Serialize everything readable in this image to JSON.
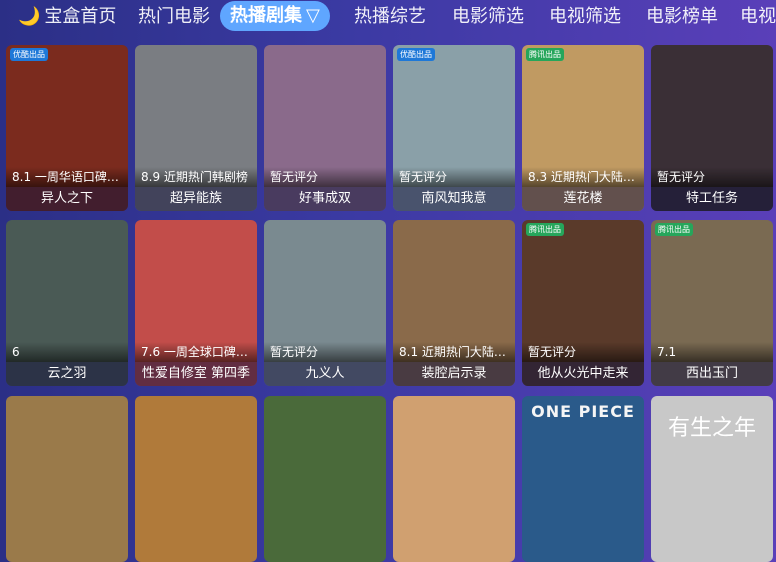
{
  "tabs": [
    {
      "label": "宝盒首页",
      "active": false,
      "icon": "moon-icon"
    },
    {
      "label": "热门电影",
      "active": false
    },
    {
      "label": "热播剧集",
      "active": true,
      "icon": "filter-icon"
    },
    {
      "label": "热播综艺",
      "active": false
    },
    {
      "label": "电影筛选",
      "active": false
    },
    {
      "label": "电视筛选",
      "active": false
    },
    {
      "label": "电影榜单",
      "active": false
    },
    {
      "label": "电视",
      "active": false
    }
  ],
  "row1": [
    {
      "title": "异人之下",
      "info": "8.1 一周华语口碑…",
      "badge": "优酷出品",
      "color": "#7b2b1e"
    },
    {
      "title": "超异能族",
      "info": "8.9 近期热门韩剧榜",
      "badge": "",
      "color": "#7a7d82"
    },
    {
      "title": "好事成双",
      "info": "暂无评分",
      "badge": "",
      "color": "#8a6a8b"
    },
    {
      "title": "南风知我意",
      "info": "暂无评分",
      "badge": "优酷出品",
      "color": "#8aa0a8"
    },
    {
      "title": "莲花楼",
      "info": "8.3 近期热门大陆…",
      "badge": "腾讯出品",
      "color": "#c09a62"
    },
    {
      "title": "特工任务",
      "info": "暂无评分",
      "badge": "",
      "color": "#3a2f36"
    }
  ],
  "row2": [
    {
      "title": "云之羽",
      "info": "6",
      "badge": "",
      "color": "#4a5a55"
    },
    {
      "title": "性爱自修室 第四季",
      "info": "7.6 一周全球口碑…",
      "badge": "",
      "color": "#c24d4a"
    },
    {
      "title": "九义人",
      "info": "暂无评分",
      "badge": "",
      "color": "#7a8a90"
    },
    {
      "title": "装腔启示录",
      "info": "8.1 近期热门大陆…",
      "badge": "",
      "color": "#8a6a4a"
    },
    {
      "title": "他从火光中走来",
      "info": "暂无评分",
      "badge": "腾讯出品",
      "color": "#5a3a2a"
    },
    {
      "title": "西出玉门",
      "info": "7.1",
      "badge": "腾讯出品",
      "color": "#7a6a52"
    }
  ],
  "row3": [
    {
      "title": "",
      "info": "",
      "badge": "",
      "color": "#9a7a4a"
    },
    {
      "title": "",
      "info": "",
      "badge": "",
      "color": "#b07a3a"
    },
    {
      "title": "",
      "info": "",
      "badge": "",
      "color": "#4a6a3a"
    },
    {
      "title": "",
      "info": "",
      "badge": "",
      "color": "#d0a070"
    },
    {
      "title": "",
      "info": "",
      "badge": "",
      "color": "#2a5a8a"
    },
    {
      "title": "",
      "info": "",
      "badge": "",
      "color": "#c8c8c8"
    }
  ],
  "poster_text": {
    "r3c5": "ONE PIECE",
    "r3c6": "有生之年"
  }
}
